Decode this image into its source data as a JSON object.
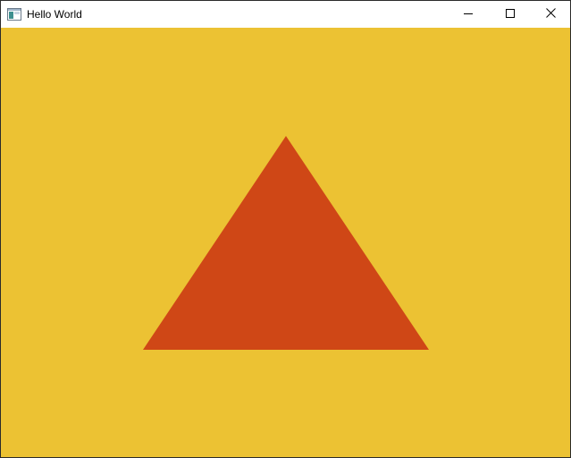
{
  "window": {
    "title": "Hello World",
    "icon": "app-window-icon",
    "controls": {
      "minimize_icon": "minimize-icon",
      "maximize_icon": "maximize-icon",
      "close_icon": "close-icon"
    }
  },
  "canvas": {
    "background_color": "#ecc233",
    "shape": "triangle",
    "shape_color": "#cf4716"
  }
}
